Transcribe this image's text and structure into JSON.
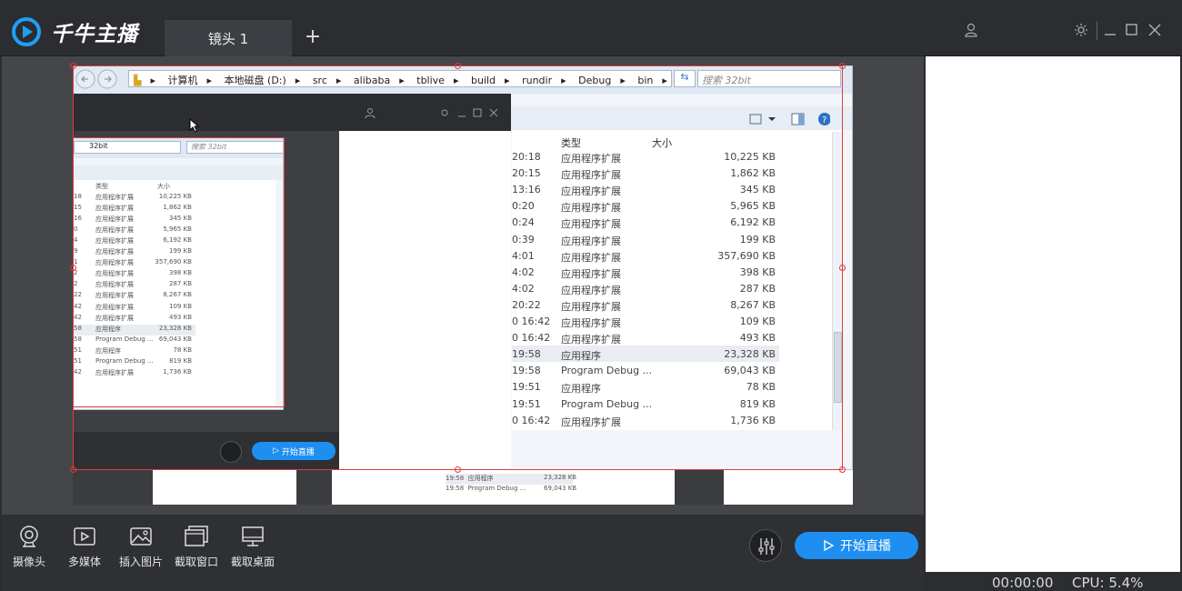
{
  "app": {
    "brand": "千牛主播"
  },
  "tabs": [
    {
      "label": "镜头 1"
    }
  ],
  "toolbar": {
    "camera": "摄像头",
    "multimedia": "多媒体",
    "insert_image": "插入图片",
    "capture_window": "截取窗口",
    "capture_desktop": "截取桌面",
    "start_live": "开始直播"
  },
  "status": {
    "time": "00:00:00",
    "cpu": "CPU: 5.4%"
  },
  "explorer": {
    "path": [
      "计算机",
      "本地磁盘 (D:)",
      "src",
      "alibaba",
      "tblive",
      "build",
      "rundir",
      "Debug",
      "bin",
      "32bit"
    ],
    "search_placeholder": "搜索 32bit",
    "col_type": "类型",
    "col_size": "大小",
    "rows": [
      {
        "time": "20:18",
        "type": "应用程序扩展",
        "size": "10,225 KB"
      },
      {
        "time": "20:15",
        "type": "应用程序扩展",
        "size": "1,862 KB"
      },
      {
        "time": "13:16",
        "type": "应用程序扩展",
        "size": "345 KB"
      },
      {
        "time": "0:20",
        "type": "应用程序扩展",
        "size": "5,965 KB"
      },
      {
        "time": "0:24",
        "type": "应用程序扩展",
        "size": "6,192 KB"
      },
      {
        "time": "0:39",
        "type": "应用程序扩展",
        "size": "199 KB"
      },
      {
        "time": "4:01",
        "type": "应用程序扩展",
        "size": "357,690 KB"
      },
      {
        "time": "4:02",
        "type": "应用程序扩展",
        "size": "398 KB"
      },
      {
        "time": "4:02",
        "type": "应用程序扩展",
        "size": "287 KB"
      },
      {
        "time": "20:22",
        "type": "应用程序扩展",
        "size": "8,267 KB"
      },
      {
        "time": "0 16:42",
        "type": "应用程序扩展",
        "size": "109 KB"
      },
      {
        "time": "0 16:42",
        "type": "应用程序扩展",
        "size": "493 KB"
      },
      {
        "time": "19:58",
        "type": "应用程序",
        "size": "23,328 KB"
      },
      {
        "time": "19:58",
        "type": "Program Debug ...",
        "size": "69,043 KB"
      },
      {
        "time": "19:51",
        "type": "应用程序",
        "size": "78 KB"
      },
      {
        "time": "19:51",
        "type": "Program Debug ...",
        "size": "819 KB"
      },
      {
        "time": "0 16:42",
        "type": "应用程序扩展",
        "size": "1,736 KB"
      }
    ],
    "mini_rows": [
      {
        "time": "18",
        "type": "应用程序扩展",
        "size": "10,225 KB"
      },
      {
        "time": "15",
        "type": "应用程序扩展",
        "size": "1,862 KB"
      },
      {
        "time": "16",
        "type": "应用程序扩展",
        "size": "345 KB"
      },
      {
        "time": "0",
        "type": "应用程序扩展",
        "size": "5,965 KB"
      },
      {
        "time": "4",
        "type": "应用程序扩展",
        "size": "6,192 KB"
      },
      {
        "time": "9",
        "type": "应用程序扩展",
        "size": "199 KB"
      },
      {
        "time": "1",
        "type": "应用程序扩展",
        "size": "357,690 KB"
      },
      {
        "time": "2",
        "type": "应用程序扩展",
        "size": "398 KB"
      },
      {
        "time": "2",
        "type": "应用程序扩展",
        "size": "287 KB"
      },
      {
        "time": "22",
        "type": "应用程序扩展",
        "size": "8,267 KB"
      },
      {
        "time": "42",
        "type": "应用程序扩展",
        "size": "109 KB"
      },
      {
        "time": "42",
        "type": "应用程序扩展",
        "size": "493 KB"
      },
      {
        "time": "58",
        "type": "应用程序",
        "size": "23,328 KB"
      },
      {
        "time": "58",
        "type": "Program Debug ...",
        "size": "69,043 KB"
      },
      {
        "time": "51",
        "type": "应用程序",
        "size": "78 KB"
      },
      {
        "time": "51",
        "type": "Program Debug ...",
        "size": "819 KB"
      },
      {
        "time": "42",
        "type": "应用程序扩展",
        "size": "1,736 KB"
      }
    ],
    "mini_path": "32bit",
    "mini_search": "搜索 32bit"
  },
  "colors": {
    "accent": "#1e8ff0",
    "selection": "#e23b3b"
  }
}
